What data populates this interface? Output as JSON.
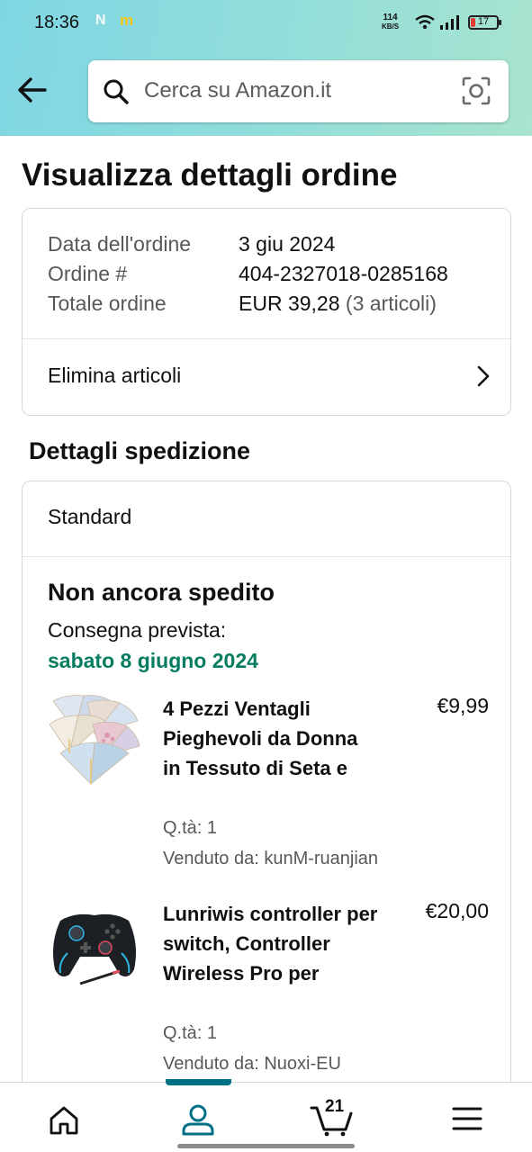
{
  "status_bar": {
    "time": "18:36",
    "icon_n": "N",
    "icon_m": "m",
    "net_speed_value": "114",
    "net_speed_unit": "KB/S",
    "battery": "17",
    "battery_level": 0.17,
    "icons": [
      "wifi-icon",
      "signal-icon",
      "battery-icon"
    ]
  },
  "header": {
    "back_icon": "arrow-left-icon",
    "search_placeholder": "Cerca su Amazon.it",
    "camera_icon": "camera-scan-icon"
  },
  "page_title": "Visualizza dettagli ordine",
  "order_summary": {
    "rows": [
      {
        "label": "Data dell'ordine",
        "value": "3 giu 2024"
      },
      {
        "label": "Ordine #",
        "value": "404-2327018-0285168"
      },
      {
        "label": "Totale ordine",
        "value": "EUR 39,28",
        "extra": " (3 articoli)"
      }
    ],
    "action": "Elimina articoli"
  },
  "shipping": {
    "section_title": "Dettagli spedizione",
    "method": "Standard",
    "status": "Non ancora spedito",
    "delivery_label": "Consegna prevista:",
    "delivery_date": "sabato 8 giugno 2024",
    "items": [
      {
        "title": "4 Pezzi Ventagli Pieghevoli da Donna in Tessuto di Seta e",
        "price": "€9,99",
        "qty": "Q.tà: 1",
        "seller": "Venduto da: kunM-ruanjian"
      },
      {
        "title": "Lunriwis controller per switch, Controller Wireless Pro per",
        "price": "€20,00",
        "qty": "Q.tà: 1",
        "seller": "Venduto da: Nuoxi-EU"
      }
    ]
  },
  "bottom_nav": {
    "items": [
      "home-icon",
      "account-icon",
      "cart-icon",
      "menu-icon"
    ],
    "active": "account-icon",
    "cart_count": "21"
  },
  "colors": {
    "accent": "#007185",
    "delivery_green": "#067d62",
    "header_gradient_start": "#7fd6e3",
    "header_gradient_end": "#a8e4cf"
  }
}
